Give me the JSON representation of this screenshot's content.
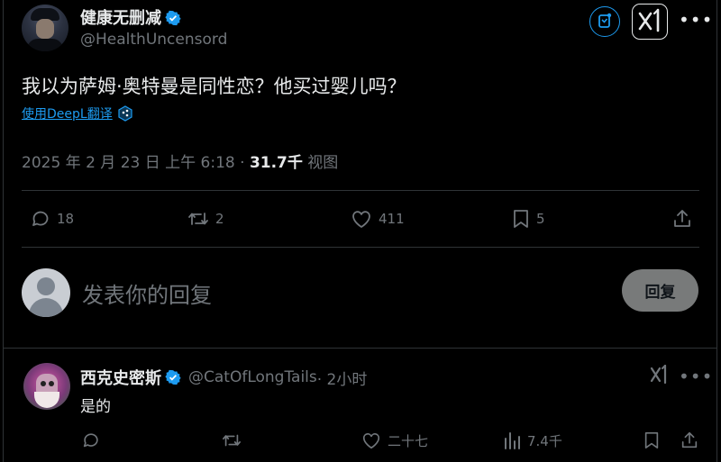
{
  "post": {
    "author_name": "健康无删减",
    "author_handle": "@HealthUncensord",
    "text": "我以为萨姆·奥特曼是同性恋？他买过婴儿吗？",
    "translate_link": "使用DeepL翻译",
    "date": "2025 年 2 月 23 日 上午 6:18 · ",
    "views_count": "31.7千",
    "views_label": " 视图",
    "stats": {
      "replies": "18",
      "reposts": "2",
      "likes": "411",
      "bookmarks": "5"
    }
  },
  "composer": {
    "placeholder": "发表你的回复",
    "submit_label": "回复"
  },
  "comment": {
    "author_name": "西克史密斯",
    "author_handle": "@CatOfLongTails",
    "time": " · 2小时",
    "text": "是的",
    "stats": {
      "likes": "二十七",
      "views": "7.4千"
    }
  },
  "icons": {
    "verified": "verified-badge-icon",
    "grok": "grok-icon",
    "xai": "xai-icon",
    "more": "more-icon",
    "reply": "reply-icon",
    "repost": "repost-icon",
    "like": "like-icon",
    "bookmark": "bookmark-icon",
    "share": "share-icon",
    "views": "views-icon",
    "deepl": "deepl-icon"
  },
  "colors": {
    "background": "#000000",
    "text": "#e7e9ea",
    "muted": "#71767b",
    "accent": "#1d9bf0",
    "divider": "#2f3336",
    "reply_button": "#787a7a"
  }
}
